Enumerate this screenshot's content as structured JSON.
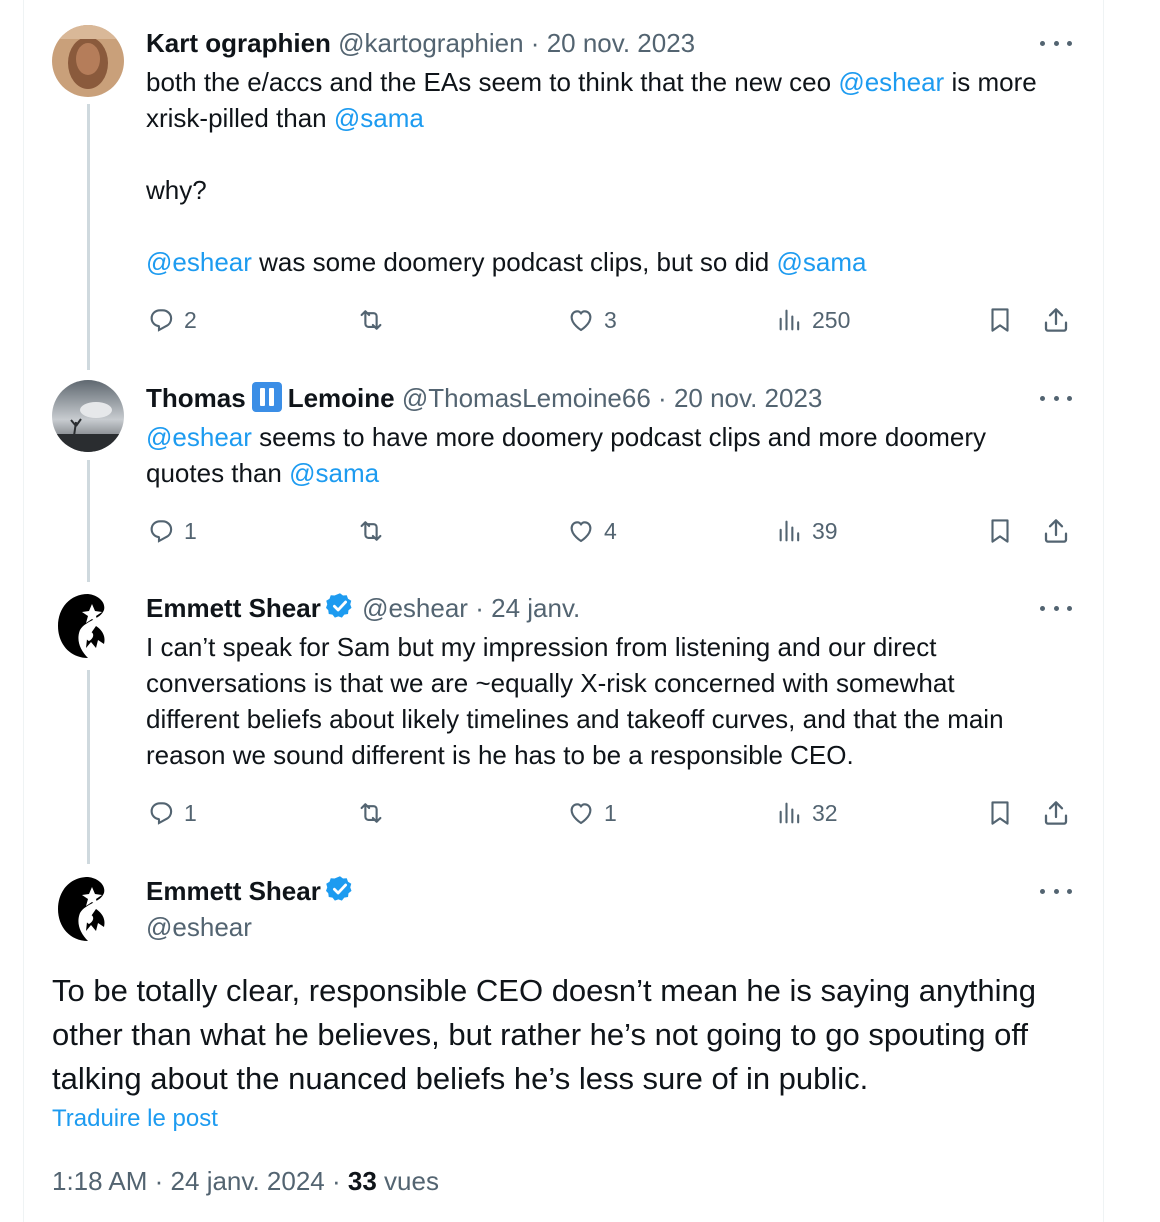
{
  "tweets": [
    {
      "name": "Kart ographien",
      "handle": "@kartographien",
      "dot": "·",
      "date": "20 nov. 2023",
      "text": {
        "p1": "both the e/accs and the EAs seem to think that the new ceo ",
        "m1": "@eshear",
        "p2": " is more xrisk-pilled than ",
        "m2": "@sama",
        "p3": "why?",
        "m3": "@eshear",
        "p4": " was some doomery podcast clips, but so did ",
        "m4": "@sama"
      },
      "replies": "2",
      "reposts": "",
      "likes": "3",
      "views": "250"
    },
    {
      "name_part1": "Thomas",
      "name_part2": "Lemoine",
      "handle": "@ThomasLemoine66",
      "dot": "·",
      "date": "20 nov. 2023",
      "text": {
        "m1": "@eshear",
        "p1": " seems to have more doomery podcast clips and more doomery quotes than ",
        "m2": "@sama"
      },
      "replies": "1",
      "reposts": "",
      "likes": "4",
      "views": "39"
    },
    {
      "name": "Emmett Shear",
      "handle": "@eshear",
      "dot": "·",
      "date": "24 janv.",
      "text": "I can’t speak for Sam but my impression from listening and our direct conversations is that we are ~equally X-risk concerned with somewhat different beliefs about likely timelines and takeoff curves, and that the main reason we sound different is he has to be a responsible CEO.",
      "replies": "1",
      "reposts": "",
      "likes": "1",
      "views": "32"
    }
  ],
  "main_tweet": {
    "name": "Emmett Shear",
    "handle": "@eshear",
    "text": "To be totally clear, responsible CEO doesn’t mean he is saying anything other than what he believes, but rather he’s not going to go spouting off talking about the nuanced beliefs he’s less sure of in public.",
    "translate_label": "Traduire le post",
    "time": "1:18 AM",
    "dot": "·",
    "date": "24 janv. 2024",
    "views_count": "33",
    "views_label": "vues"
  },
  "icons": {
    "reply": "reply-icon",
    "repost": "repost-icon",
    "like": "heart-icon",
    "views": "views-icon",
    "bookmark": "bookmark-icon",
    "share": "share-icon",
    "more": "more-icon",
    "verified": "verified-badge-icon"
  },
  "colors": {
    "accent": "#1d9bf0",
    "muted": "#536471",
    "text": "#0f1419",
    "thread_line": "#cfd9de"
  }
}
